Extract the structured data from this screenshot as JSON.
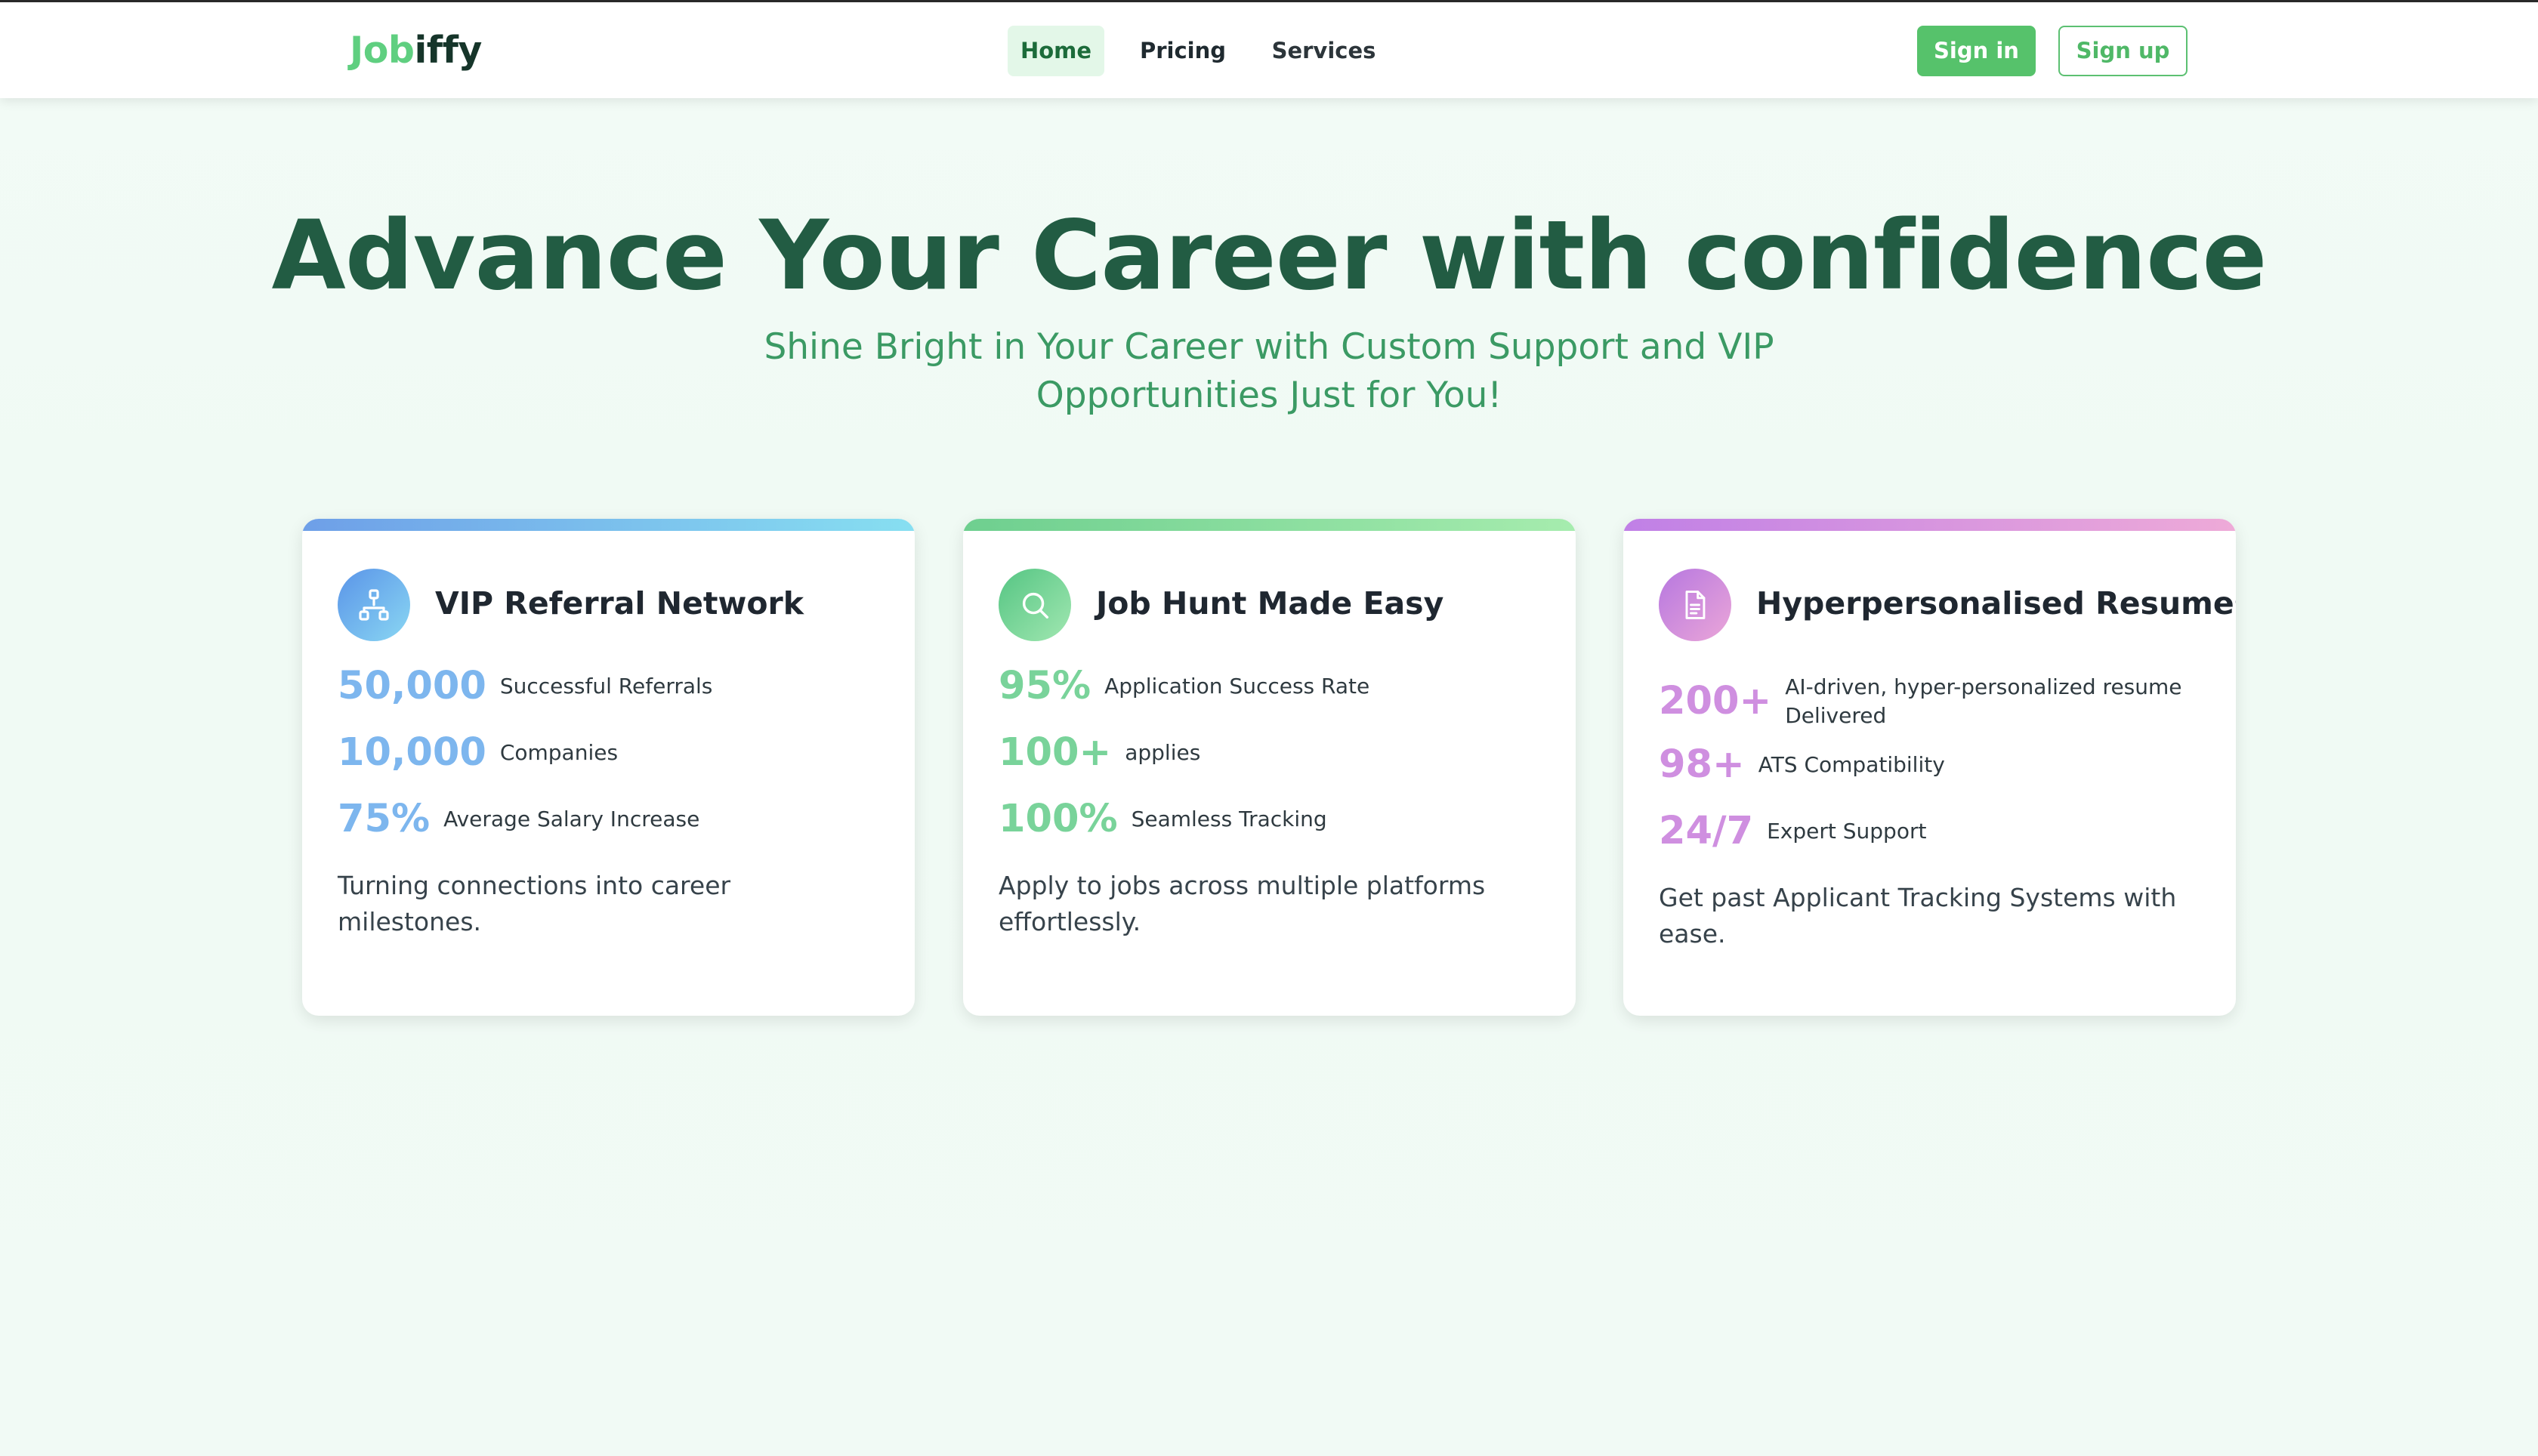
{
  "brand": {
    "logo_part1": "Job",
    "logo_part2": "iffy"
  },
  "nav": {
    "items": [
      {
        "label": "Home",
        "active": true
      },
      {
        "label": "Pricing",
        "active": false
      },
      {
        "label": "Services",
        "active": false
      }
    ],
    "sign_in": "Sign in",
    "sign_up": "Sign up"
  },
  "hero": {
    "title": "Advance Your Career with confidence",
    "subtitle": "Shine Bright in Your Career with Custom Support and VIP Opportunities Just for You!"
  },
  "cards": [
    {
      "icon": "network-icon",
      "title": "VIP Referral Network",
      "stats": [
        {
          "value": "50,000",
          "label": "Successful Referrals"
        },
        {
          "value": "10,000",
          "label": "Companies"
        },
        {
          "value": "75%",
          "label": "Average Salary Increase"
        }
      ],
      "description": "Turning connections into career milestones."
    },
    {
      "icon": "search-icon",
      "title": "Job Hunt Made Easy",
      "stats": [
        {
          "value": "95%",
          "label": "Application Success Rate"
        },
        {
          "value": "100+",
          "label": "applies"
        },
        {
          "value": "100%",
          "label": "Seamless Tracking"
        }
      ],
      "description": "Apply to jobs across multiple platforms effortlessly."
    },
    {
      "icon": "document-icon",
      "title": "Hyperpersonalised Resumes",
      "stats": [
        {
          "value": "200+",
          "label": "AI-driven, hyper-personalized resume Delivered"
        },
        {
          "value": "98+",
          "label": "ATS Compatibility"
        },
        {
          "value": "24/7",
          "label": "Expert Support"
        }
      ],
      "description": "Get past Applicant Tracking Systems with ease."
    }
  ],
  "colors": {
    "brand_green": "#5fcf80",
    "heading_green": "#225c43",
    "subtitle_green": "#3b9a64",
    "button_green": "#56c26b"
  }
}
